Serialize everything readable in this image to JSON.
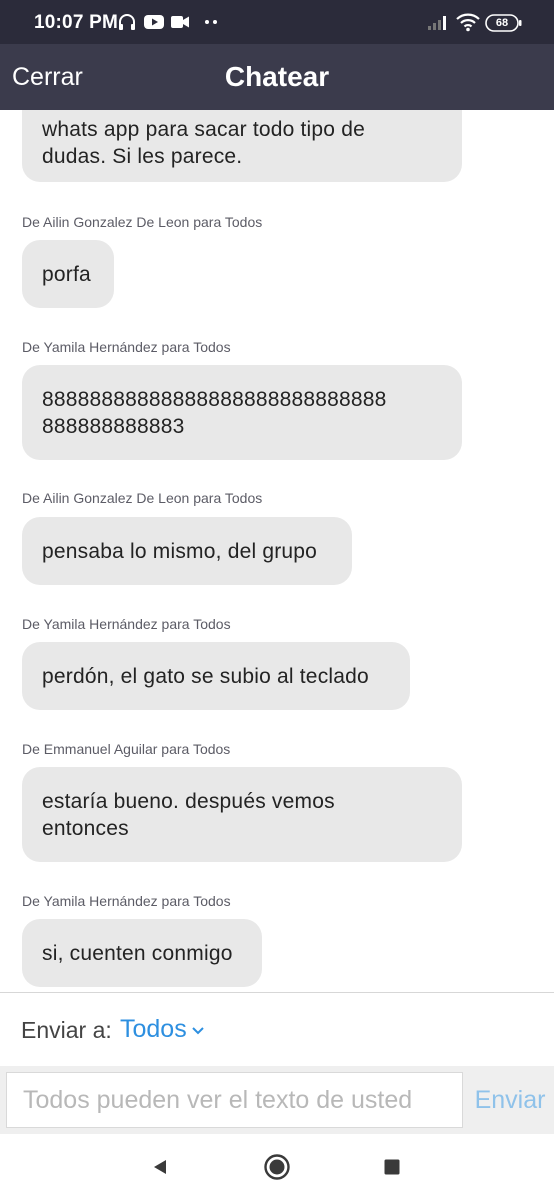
{
  "status_bar": {
    "time": "10:07 PM",
    "battery": "68",
    "icons": [
      "headphones-icon",
      "youtube-icon",
      "video-camera-icon",
      "more-dots-icon",
      "signal-icon",
      "wifi-icon",
      "battery-icon"
    ]
  },
  "header": {
    "close_label": "Cerrar",
    "title": "Chatear"
  },
  "messages": [
    {
      "sender": "",
      "lines": [
        "whats app para sacar todo tipo de",
        "dudas. Si les parece."
      ]
    },
    {
      "sender": "De Ailin Gonzalez De Leon para Todos",
      "lines": [
        "porfa"
      ]
    },
    {
      "sender": "De Yamila Hernández para Todos",
      "lines": [
        "88888888888888888888888888888",
        "888888888883"
      ]
    },
    {
      "sender": "De Ailin Gonzalez De Leon para Todos",
      "lines": [
        "pensaba lo mismo, del grupo"
      ]
    },
    {
      "sender": "De Yamila Hernández para Todos",
      "lines": [
        "perdón, el gato se subio al teclado"
      ]
    },
    {
      "sender": "De Emmanuel Aguilar para Todos",
      "lines": [
        "estaría bueno. después vemos",
        "entonces"
      ]
    },
    {
      "sender": "De Yamila Hernández para Todos",
      "lines": [
        "si, cuenten conmigo"
      ]
    }
  ],
  "send_to": {
    "label": "Enviar a:",
    "value": "Todos"
  },
  "composer": {
    "placeholder": "Todos pueden ver el texto de usted",
    "value": "",
    "send_label": "Enviar"
  },
  "colors": {
    "header_bg": "#3b3b4c",
    "status_bg": "#2b2b3a",
    "bubble_bg": "#e8e8e8",
    "accent": "#2d8fe0",
    "send_disabled": "#8fc2ea"
  }
}
